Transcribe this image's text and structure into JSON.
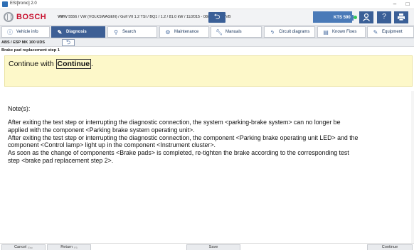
{
  "window": {
    "title": "ESI[tronic] 2.0",
    "minimize": "–",
    "maximize": "□"
  },
  "header": {
    "brand": "BOSCH",
    "vehicle_bold": "VW",
    "vehicle_text": "W 5556 / VW (VOLKSWAGEN) / Golf VII 1.2 TSI / BQ1 / 1.2 / 81.0 kW / 11/2015 - 08/2020 / CYVB",
    "device": "KTS 590",
    "device_status_color": "#34c759",
    "icons": [
      "person-icon",
      "help-icon",
      "print-icon"
    ]
  },
  "nav": {
    "tabs": [
      {
        "label": "Vehicle info",
        "icon": "info-icon",
        "active": false
      },
      {
        "label": "Diagnosis",
        "icon": "stethoscope-icon",
        "active": true
      },
      {
        "label": "Search",
        "icon": "search-icon",
        "active": false
      },
      {
        "label": "Maintenance",
        "icon": "gears-icon",
        "active": false
      },
      {
        "label": "Manuals",
        "icon": "wrench-icon",
        "active": false
      },
      {
        "label": "Circuit diagrams",
        "icon": "lightning-icon",
        "active": false
      },
      {
        "label": "Known Fixes",
        "icon": "book-icon",
        "active": false
      },
      {
        "label": "Equipment",
        "icon": "edit-icon",
        "active": false
      }
    ]
  },
  "breadcrumb": {
    "path": "ABS / ESP MK 100 UDS"
  },
  "step": {
    "title": "Brake pad replacement step 1",
    "instruction_prefix": "Continue with ",
    "instruction_link": "Continue",
    "instruction_suffix": "."
  },
  "notes": {
    "label": "Note(s):",
    "lines": [
      "After exiting the test step or interrupting the diagnostic connection, the system <parking-brake system> can no longer be",
      "applied with the component <Parking brake system operating unit>.",
      "After exiting the test step or interrupting the diagnostic connection, the component <Parking brake operating unit LED> and the",
      "component <Control lamp> light up in the component <Instrument cluster>.",
      "As soon as the change of components <Brake pads> is completed, re-tighten the brake according to the corresponding test",
      "step <brake pad replacement step 2>."
    ]
  },
  "footer": {
    "cancel": "Cancel",
    "cancel_key": "Esc",
    "return": "Return",
    "return_key": "F5",
    "save": "Save",
    "continue": "Continue"
  },
  "colors": {
    "accent": "#3d5f95",
    "brand_red": "#c8102e",
    "instruction_bg": "#fdf8c9"
  }
}
